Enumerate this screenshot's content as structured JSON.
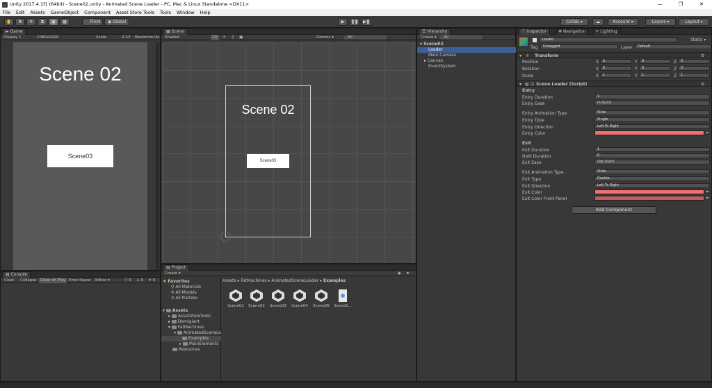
{
  "window": {
    "title": "Unity 2017.4.1f1 (64bit) - Scene02.unity - Animated Scene Loader - PC, Mac & Linux Standalone <DX11>"
  },
  "menu": [
    "File",
    "Edit",
    "Assets",
    "GameObject",
    "Component",
    "Asset Store Tools",
    "Tools",
    "Window",
    "Help"
  ],
  "toolbar": {
    "pivot": "Pivot",
    "global": "Global",
    "collab": "Collab ▾",
    "account": "Account",
    "layers": "Layers",
    "layout": "Layout"
  },
  "game": {
    "tab": "Game",
    "display": "Display 1",
    "resolution": "1080x1920",
    "scale_label": "Scale",
    "scale_value": "0.33",
    "maximize": "Maximize On",
    "title": "Scene 02",
    "button": "Scene03"
  },
  "scene": {
    "tab": "Scene",
    "shaded": "Shaded",
    "mode2d": "2D",
    "gizmos": "Gizmos ▾",
    "search": "All",
    "title": "Scene 02",
    "button": "Scene03"
  },
  "hierarchy": {
    "tab": "Hierarchy",
    "create": "Create ▾",
    "search": "All",
    "scene": "Scene02",
    "items": [
      "Loader",
      "Main Camera",
      "Canvas",
      "EventSystem"
    ]
  },
  "inspector": {
    "tabs": [
      "Inspector",
      "Navigation",
      "Lighting"
    ],
    "object_name": "Loader",
    "static": "Static ▾",
    "tag_label": "Tag",
    "tag_value": "Untagged",
    "layer_label": "Layer",
    "layer_value": "Default",
    "transform": {
      "title": "Transform",
      "position": "Position",
      "rotation": "Rotation",
      "scale": "Scale",
      "px": "0",
      "py": "0",
      "pz": "0",
      "rx": "0",
      "ry": "0",
      "rz": "0",
      "sx": "1",
      "sy": "1",
      "sz": "1"
    },
    "script": {
      "title": "Scene Loader (Script)",
      "entry": "Entry",
      "entry_duration_l": "Entry Duration",
      "entry_duration": "1",
      "entry_ease_l": "Entry Ease",
      "entry_ease": "In Quint",
      "entry_anim_l": "Entry Animation Type",
      "entry_anim": "Slide",
      "entry_type_l": "Entry Type",
      "entry_type": "Single",
      "entry_dir_l": "Entry Direction",
      "entry_dir": "Left To Right",
      "entry_color_l": "Entry Color",
      "exit": "Exit",
      "exit_duration_l": "Exit Duration",
      "exit_duration": "1",
      "hold_l": "Hold Duration",
      "hold": "0",
      "exit_ease_l": "Exit Ease",
      "exit_ease": "Out Quint",
      "exit_anim_l": "Exit Animation Type",
      "exit_anim": "Slide",
      "exit_type_l": "Exit Type",
      "exit_type": "Double",
      "exit_dir_l": "Exit Direction",
      "exit_dir": "Left To Right",
      "exit_color_l": "Exit Color",
      "exit_front_l": "Exit Color Front Panel"
    },
    "add_component": "Add Component",
    "colors": {
      "entry": "#f07070",
      "exit": "#f07070",
      "front": "#c85a5a"
    }
  },
  "console": {
    "tab": "Console",
    "clear": "Clear",
    "collapse": "Collapse",
    "clear_on_play": "Clear on Play",
    "error_pause": "Error Pause",
    "editor": "Editor ▾",
    "c1": "0",
    "c2": "0",
    "c3": "0"
  },
  "project": {
    "tab": "Project",
    "create": "Create ▾",
    "breadcrumb": [
      "Assets",
      "FatMachines",
      "AnimatedSceneLoader",
      "Examples"
    ],
    "favorites": "Favorites",
    "fav_items": [
      "All Materials",
      "All Models",
      "All Prefabs"
    ],
    "assets": "Assets",
    "tree": [
      "AssetStoreTools",
      "Demigiant",
      "FatMachines",
      "AnimatedSceneLo",
      "Examples",
      "MainElements",
      "Resources"
    ],
    "files": [
      "Scene01",
      "Scene02",
      "Scene03",
      "Scene04",
      "Scene05",
      "SceneE..."
    ]
  }
}
